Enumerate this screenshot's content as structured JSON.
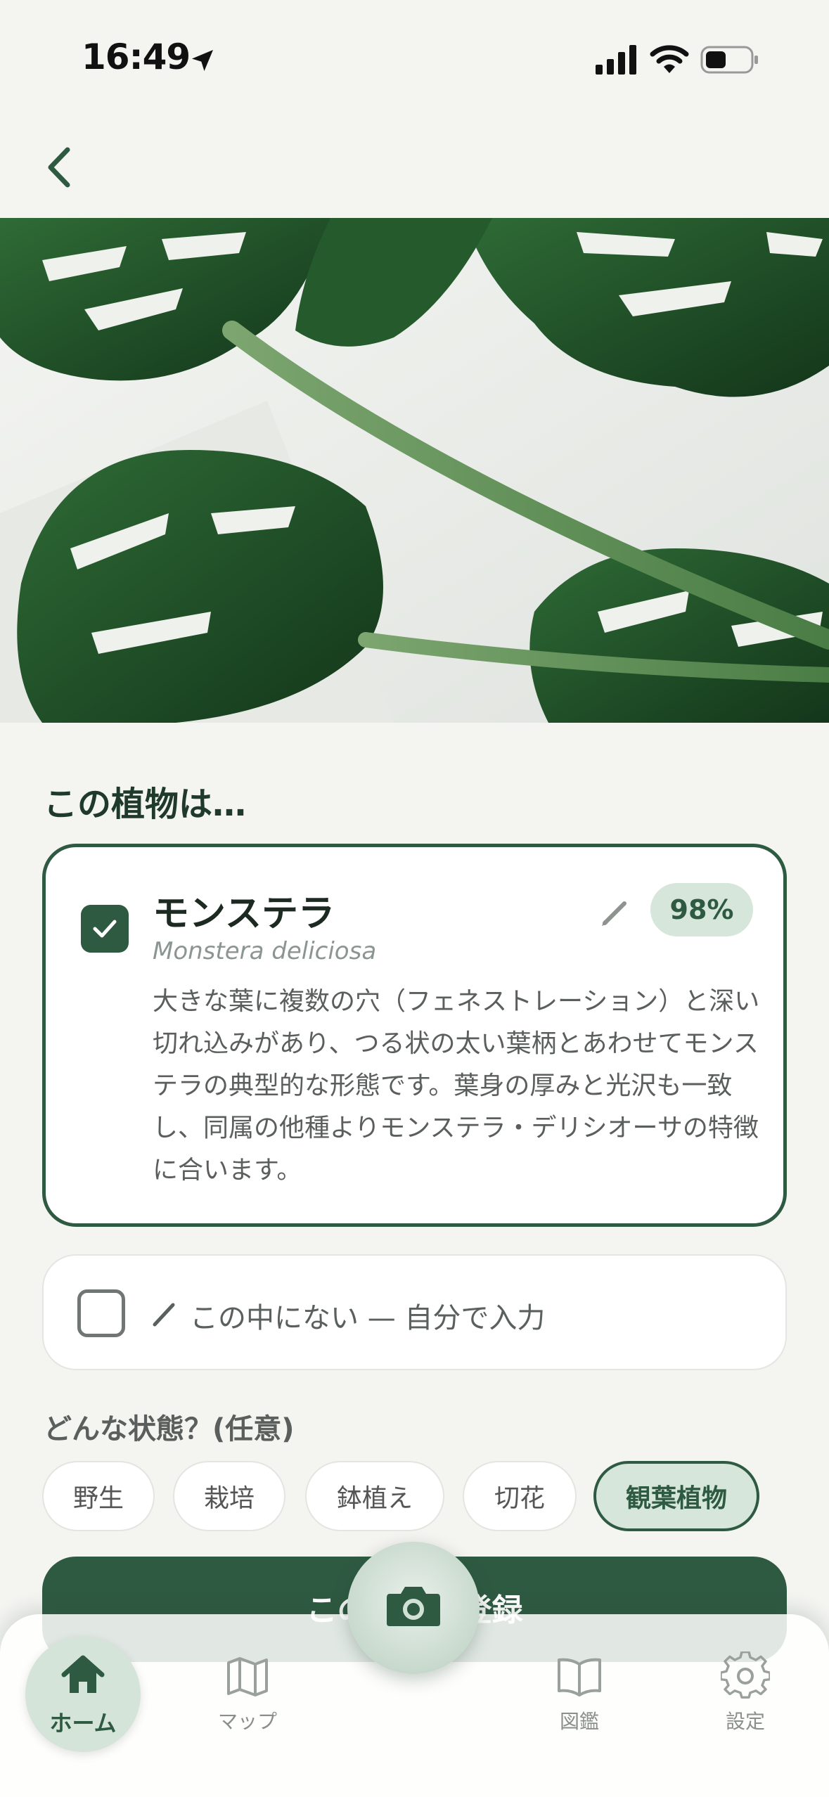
{
  "status_bar": {
    "time": "16:49"
  },
  "title": "この植物は…",
  "candidate": {
    "name": "モンステラ",
    "scientific_name": "Monstera deliciosa",
    "confidence": "98%",
    "description": "大きな葉に複数の穴（フェネストレーション）と深い切れ込みがあり、つる状の太い葉柄とあわせてモンステラの典型的な形態です。葉身の厚みと光沢も一致し、同属の他種よりモンステラ・デリシオーサの特徴に合います。",
    "checked": true
  },
  "other_option": {
    "label": "この中にない — 自分で入力"
  },
  "state": {
    "title": "どんな状態？(任意)",
    "chips": [
      "野生",
      "栽培",
      "鉢植え",
      "切花",
      "観葉植物"
    ],
    "selected": "観葉植物"
  },
  "register_button": {
    "label": "この植物を登録"
  },
  "tabbar": {
    "home": "ホーム",
    "map": "マップ",
    "zukan": "図鑑",
    "settings": "設定"
  },
  "colors": {
    "accent": "#2f5a42",
    "accent_light": "#d6e6da",
    "background": "#f4f4f1"
  },
  "icons": [
    "location-arrow-icon",
    "signal-icon",
    "wifi-icon",
    "battery-icon",
    "back-chevron-icon",
    "checkbox-checked-icon",
    "pencil-icon",
    "camera-icon",
    "home-icon",
    "map-icon",
    "book-icon",
    "gear-icon"
  ]
}
